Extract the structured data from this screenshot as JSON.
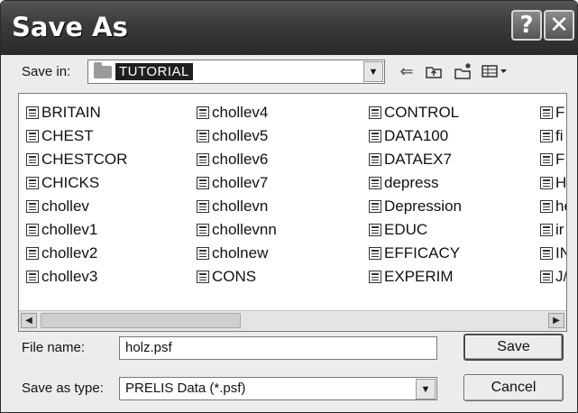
{
  "window": {
    "title": "Save As",
    "help_label": "?",
    "close_label": "✕"
  },
  "savein": {
    "label": "Save in:",
    "folder": "TUTORIAL",
    "icons": [
      "folder-icon",
      "back-icon",
      "up-folder-icon",
      "new-folder-icon",
      "views-menu-icon"
    ]
  },
  "files": {
    "col1": [
      "BRITAIN",
      "CHEST",
      "CHESTCOR",
      "CHICKS",
      "chollev",
      "chollev1",
      "chollev2",
      "chollev3"
    ],
    "col2": [
      "chollev4",
      "chollev5",
      "chollev6",
      "chollev7",
      "chollevn",
      "chollevnn",
      "cholnew",
      "CONS"
    ],
    "col3": [
      "CONTROL",
      "DATA100",
      "DATAEX7",
      "depress",
      "Depression",
      "EDUC",
      "EFFICACY",
      "EXPERIM"
    ],
    "col4": [
      "F:",
      "fi",
      "F:",
      "H",
      "he",
      "ir",
      "IN",
      "J/"
    ]
  },
  "filename": {
    "label": "File name:",
    "value": "holz.psf"
  },
  "filetype": {
    "label": "Save as type:",
    "value": "PRELIS Data (*.psf)"
  },
  "buttons": {
    "save": "Save",
    "cancel": "Cancel"
  }
}
